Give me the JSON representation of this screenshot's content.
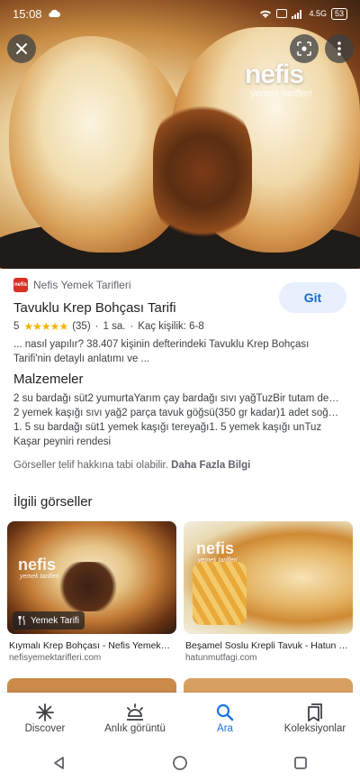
{
  "status_bar": {
    "time": "15:08",
    "network": "4.5G",
    "battery": "53"
  },
  "hero": {
    "watermark": "nefis",
    "watermark_sub": "yemek tarifleri"
  },
  "source": {
    "logo_text": "nefis",
    "name": "Nefis Yemek Tarifleri"
  },
  "visit_button": "Git",
  "recipe": {
    "title": "Tavuklu Krep Bohçası Tarifi",
    "rating": "5",
    "stars": "★★★★★",
    "reviews": "(35)",
    "time": "1 sa.",
    "servings": "Kaç kişilik: 6-8",
    "description": "... nasıl yapılır? 38.407 kişinin defterindeki Tavuklu Krep Bohçası Tarifi'nin detaylı anlatımı ve ..."
  },
  "ingredients": {
    "heading": "Malzemeler",
    "lines": [
      "2 su bardağı süt2 yumurtaYarım çay bardağı sıvı yağTuzBir tutam de…",
      "2 yemek kaşığı sıvı yağ2 parça tavuk göğsü(350 gr kadar)1 adet soğ…",
      "1. 5 su bardağı süt1 yemek kaşığı tereyağı1. 5 yemek kaşığı unTuz",
      "Kaşar peyniri rendesi"
    ]
  },
  "copyright": {
    "text": "Görseller telif hakkına tabi olabilir.",
    "link": "Daha Fazla Bilgi"
  },
  "related": {
    "heading": "İlgili görseller",
    "items": [
      {
        "watermark": "nefis",
        "watermark_sub": "yemek tarifleri",
        "chip": "Yemek Tarifi",
        "caption": "Kıymalı Krep Bohçası - Nefis Yemek…",
        "source": "nefisyemektarifleri.com"
      },
      {
        "watermark": "nefis",
        "watermark_sub": "yemek tarifleri",
        "caption": "Beşamel Soslu Krepli Tavuk - Hatun …",
        "source": "hatunmutfagi.com"
      }
    ]
  },
  "bottom_nav": [
    {
      "label": "Discover",
      "icon": "asterisk-icon"
    },
    {
      "label": "Anlık görüntü",
      "icon": "snapshot-icon"
    },
    {
      "label": "Ara",
      "icon": "search-icon",
      "active": true
    },
    {
      "label": "Koleksiyonlar",
      "icon": "collections-icon"
    }
  ],
  "colors": {
    "accent": "#1a73e8",
    "visit_bg": "#e8f0fe",
    "star": "#f4b400",
    "brand": "#d93025"
  }
}
